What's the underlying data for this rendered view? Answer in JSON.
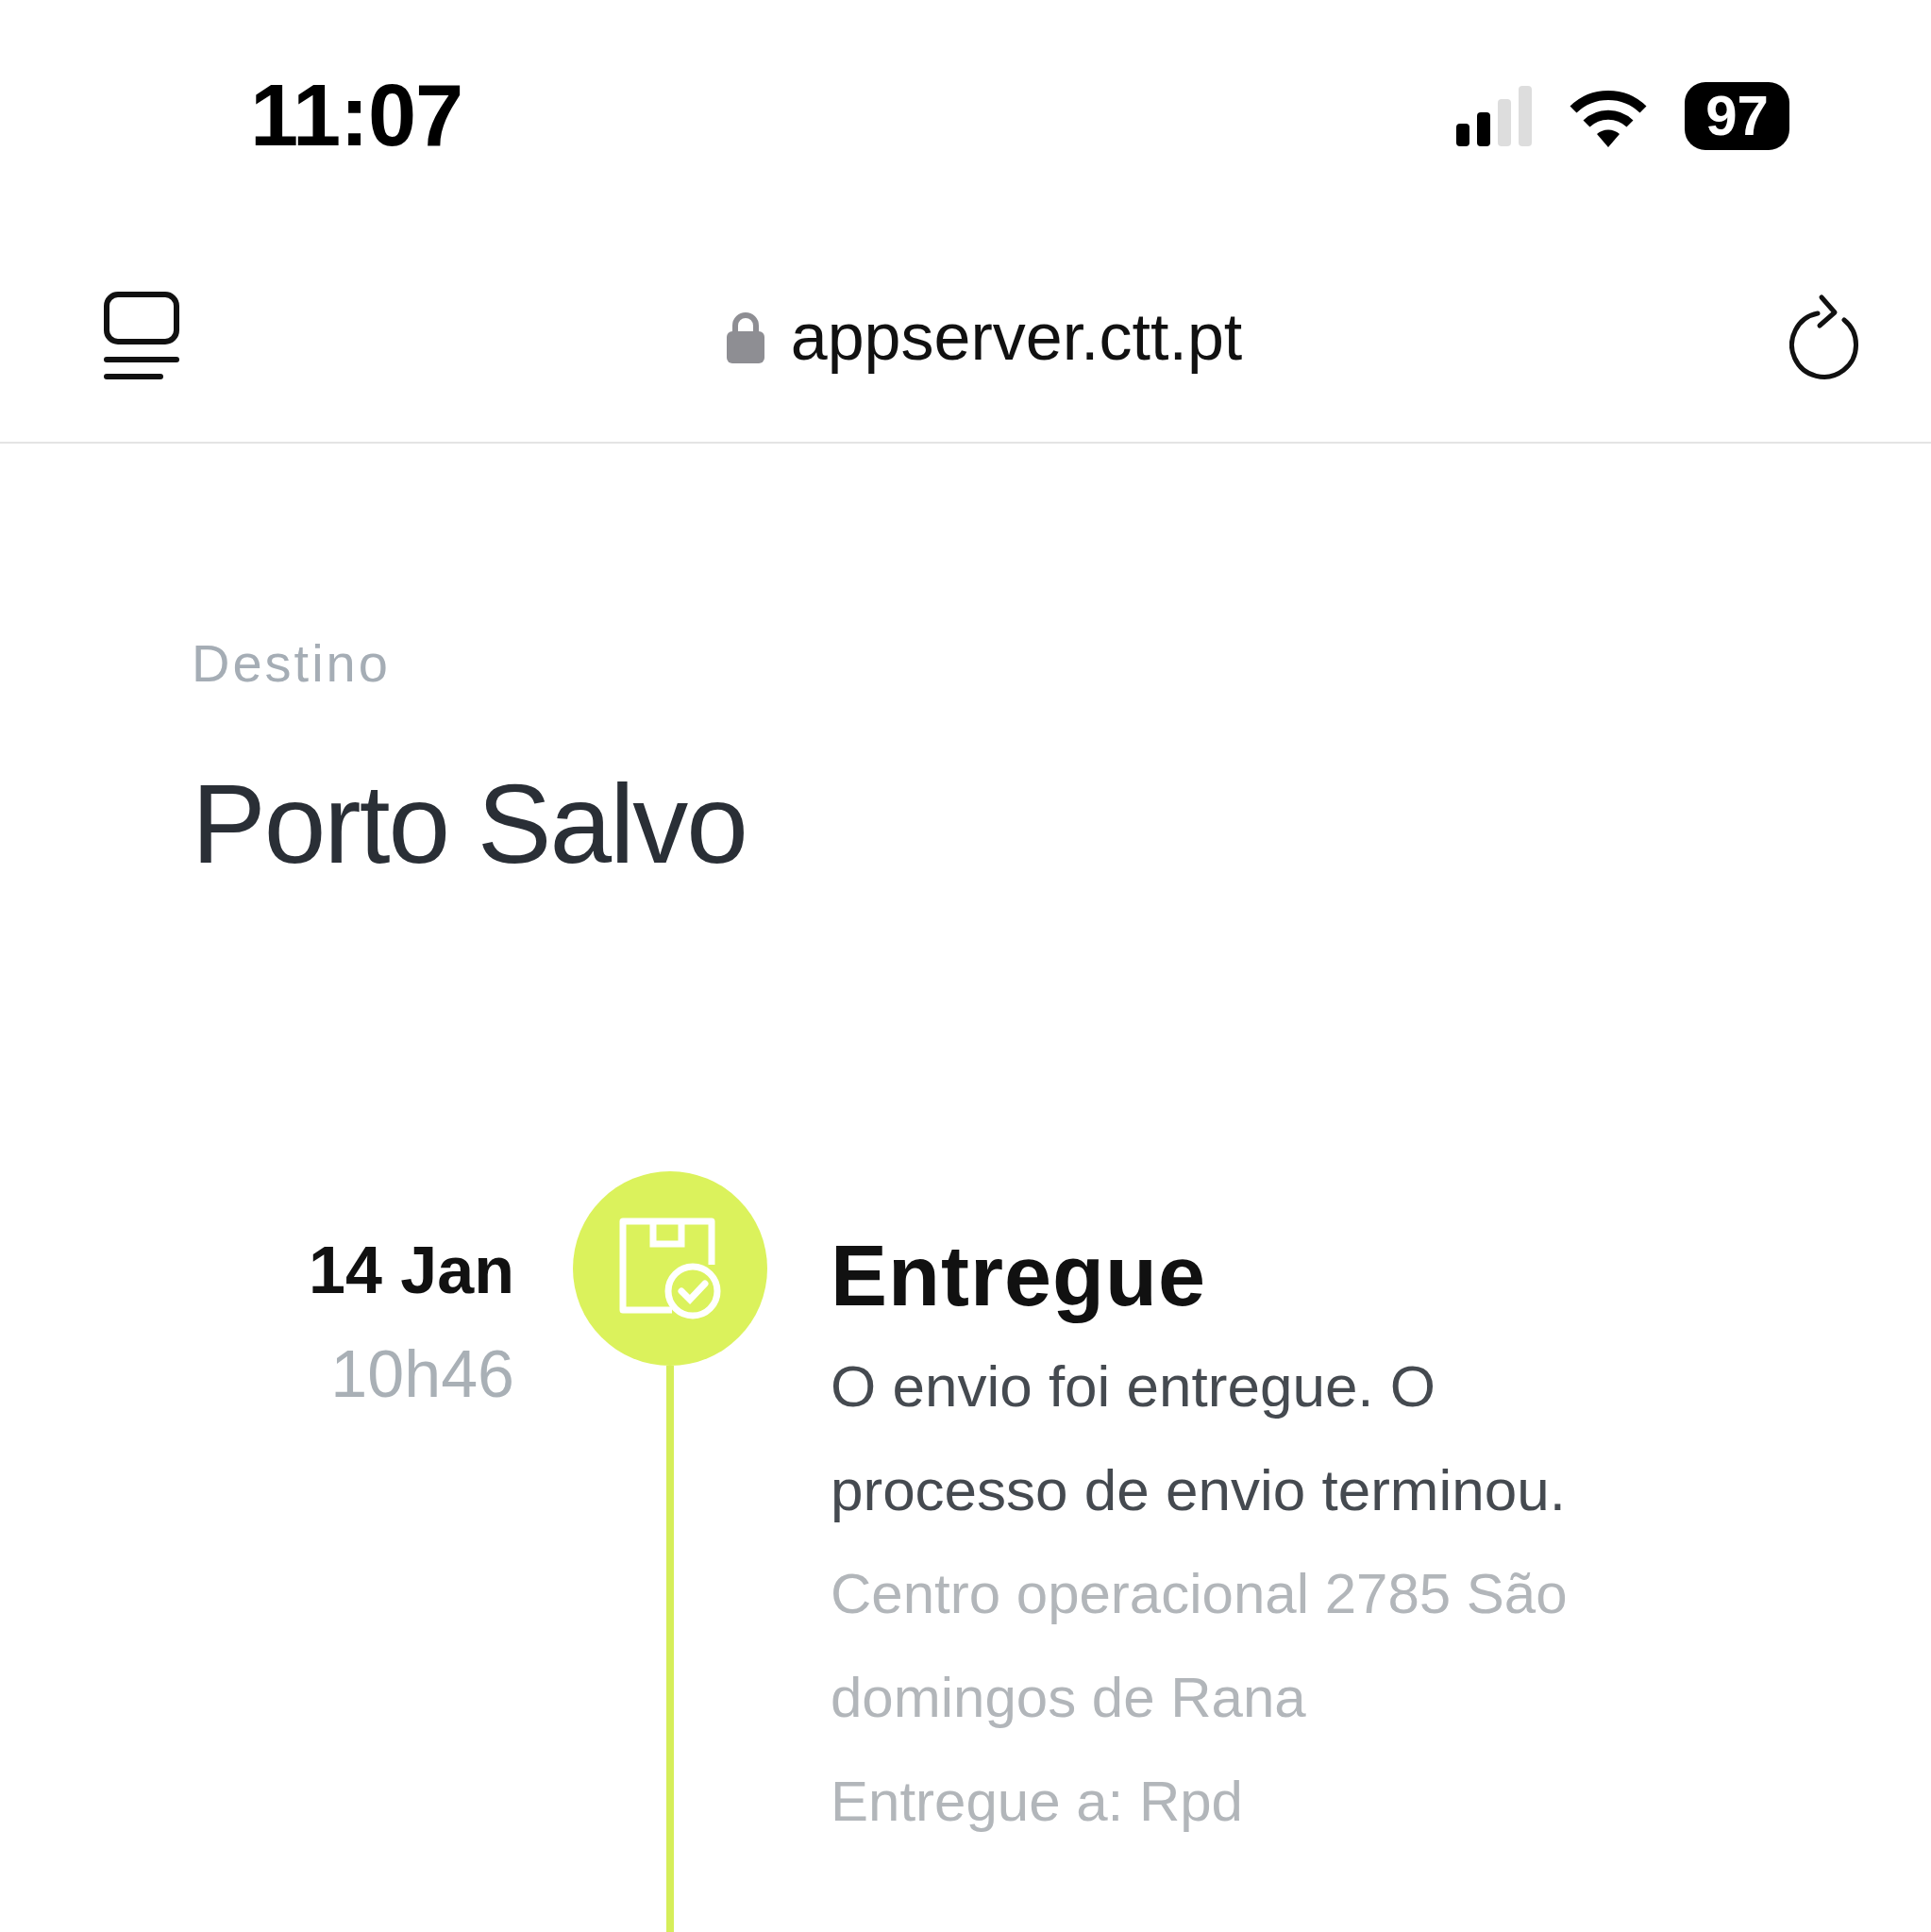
{
  "status_bar": {
    "time": "11:07",
    "battery": "97"
  },
  "browser_bar": {
    "url": "appserver.ctt.pt"
  },
  "destination": {
    "label": "Destino",
    "city": "Porto Salvo"
  },
  "events": [
    {
      "date": "14 Jan",
      "time": "10h46",
      "title": "Entregue",
      "description": "O envio foi entregue. O processo de envio terminou.",
      "details": [
        "Centro operacional 2785 São domingos de Rana",
        "Entregue a: Rpd"
      ]
    }
  ]
}
